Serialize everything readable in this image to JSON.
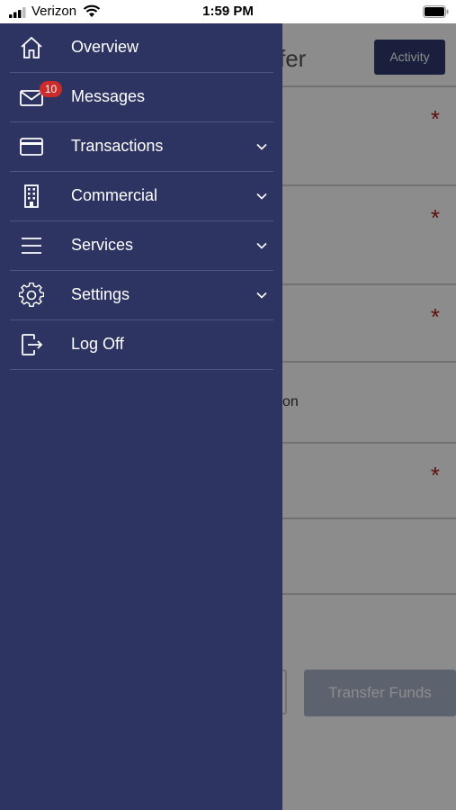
{
  "status_bar": {
    "carrier": "Verizon",
    "time": "1:59 PM"
  },
  "background": {
    "title_fragment": "fer",
    "activity_button": "Activity",
    "row_text_fragment": "on",
    "transfer_button": "Transfer Funds",
    "required_marker": "*"
  },
  "menu": {
    "items": [
      {
        "label": "Overview",
        "icon": "home-icon",
        "expandable": false
      },
      {
        "label": "Messages",
        "icon": "mail-icon",
        "badge": "10",
        "expandable": false
      },
      {
        "label": "Transactions",
        "icon": "credit-card-icon",
        "expandable": true
      },
      {
        "label": "Commercial",
        "icon": "building-icon",
        "expandable": true
      },
      {
        "label": "Services",
        "icon": "hamburger-menu-icon",
        "expandable": true
      },
      {
        "label": "Settings",
        "icon": "gear-icon",
        "expandable": true
      },
      {
        "label": "Log Off",
        "icon": "logout-icon",
        "expandable": false
      }
    ]
  },
  "colors": {
    "drawer_bg": "#2e3461",
    "badge": "#cc2b2b",
    "accent_button": "#2e3a6e",
    "required_asterisk": "#b01c1c"
  }
}
